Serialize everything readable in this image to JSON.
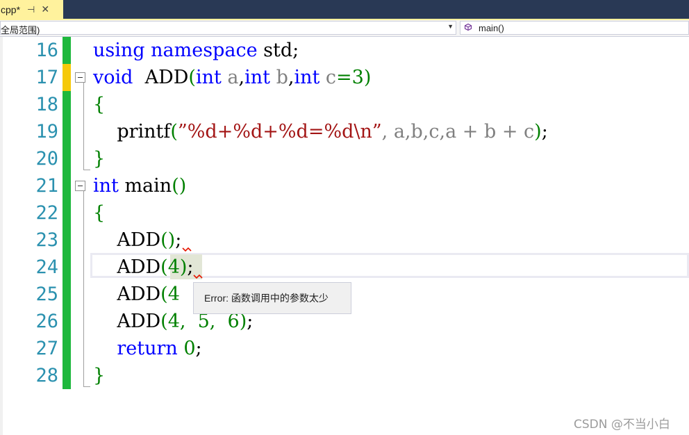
{
  "tab": {
    "name": "cpp*",
    "pin_glyph": "⊣",
    "close_glyph": "✕"
  },
  "nav": {
    "scope": "全局范围)",
    "member": "main()"
  },
  "editor": {
    "line_numbers": [
      "16",
      "17",
      "18",
      "19",
      "20",
      "21",
      "22",
      "23",
      "24",
      "25",
      "26",
      "27",
      "28"
    ],
    "lines": {
      "l16": {
        "kw1": "using",
        "kw2": "namespace",
        "rest": " std;"
      },
      "l17": {
        "kw_void": "void",
        "fn": "  ADD",
        "p_open": "(",
        "kw_int1": "int",
        "a": " a",
        "c1": ",",
        "kw_int2": "int",
        "b": " b",
        "c2": ",",
        "kw_int3": "int",
        "c": " c",
        "eq": "=3",
        "p_close": ")"
      },
      "l18": {
        "brace": "{"
      },
      "l19": {
        "fn": "printf",
        "p_open": "(",
        "str": "”%d+%d+%d=%d\\n”",
        "args": ", a,b,c,a + b + c",
        "p_close": ")",
        "semi": ";"
      },
      "l20": {
        "brace": "}"
      },
      "l21": {
        "kw_int": "int",
        "fn": " main",
        "parens": "()"
      },
      "l22": {
        "brace": "{"
      },
      "l23": {
        "fn": "ADD",
        "parens": "()",
        "semi": ";"
      },
      "l24": {
        "fn": "ADD",
        "p_open": "(",
        "arg": "4",
        "p_close": ")",
        "semi": ";"
      },
      "l25": {
        "fn": "ADD",
        "p_open": "(",
        "arg": "4"
      },
      "l26": {
        "fn": "ADD",
        "p_open": "(",
        "args": "4,  5,  6",
        "p_close": ")",
        "semi": ";"
      },
      "l27": {
        "kw_return": "return",
        "val": " 0",
        "semi": ";"
      },
      "l28": {
        "brace": "}"
      }
    }
  },
  "tooltip": {
    "text": "Error: 函数调用中的参数太少"
  },
  "watermark": "CSDN @不当小白",
  "colors": {
    "keyword": "#0000ff",
    "line_number": "#2b91af",
    "string": "#a31515",
    "change_saved": "#1eb83c",
    "change_unsaved": "#f5c90a",
    "tab_active": "#fff29d",
    "title_bar": "#293955"
  }
}
